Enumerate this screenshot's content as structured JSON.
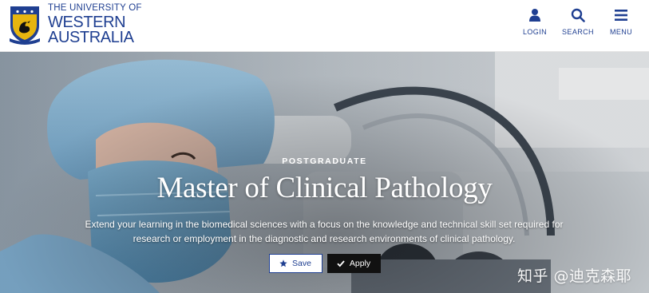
{
  "header": {
    "logo": {
      "line1": "THE UNIVERSITY OF",
      "line2": "WESTERN",
      "line3": "AUSTRALIA",
      "crest_icon": "uwa-crest-icon"
    },
    "nav": [
      {
        "label": "LOGIN",
        "icon": "user-icon"
      },
      {
        "label": "SEARCH",
        "icon": "search-icon"
      },
      {
        "label": "MENU",
        "icon": "hamburger-menu-icon"
      }
    ]
  },
  "hero": {
    "eyebrow": "POSTGRADUATE",
    "title": "Master of Clinical Pathology",
    "description_line1": "Extend your learning in the biomedical sciences with a focus on the knowledge and technical skill set required for",
    "description_line2": "research or employment in the diagnostic and research environments of clinical pathology.",
    "save_label": "Save",
    "apply_label": "Apply",
    "save_icon": "star-icon",
    "apply_icon": "checkmark-icon"
  },
  "watermark": "知乎 @迪克森耶",
  "colors": {
    "brand_blue": "#1f3f91",
    "crest_gold": "#e7b50f",
    "apply_bg": "#111111"
  }
}
